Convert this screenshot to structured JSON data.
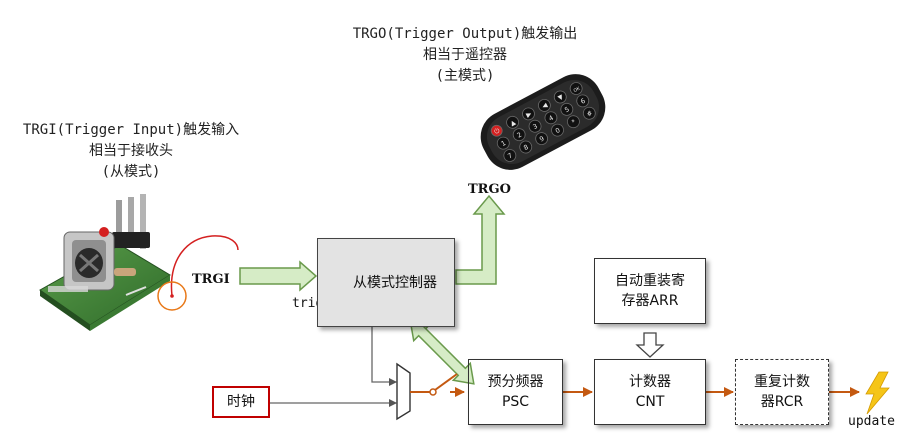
{
  "captions": {
    "trgo": [
      "TRGO(Trigger Output)触发输出",
      "相当于遥控器",
      "(主模式)"
    ],
    "trgi": [
      "TRGI(Trigger Input)触发输入",
      "相当于接收头",
      "(从模式)"
    ]
  },
  "labels": {
    "trgo": "TRGO",
    "trgi": "TRGI",
    "trigger": "trigger",
    "update": "update"
  },
  "blocks": {
    "slave_controller": "从模式控制器",
    "clock": "时钟",
    "prescaler": [
      "预分频器",
      "PSC"
    ],
    "counter": [
      "计数器",
      "CNT"
    ],
    "auto_reload": [
      "自动重装寄",
      "存器ARR"
    ],
    "repetition": [
      "重复计数",
      "器RCR"
    ]
  },
  "remote_keys": [
    "⏻",
    "▲",
    "▶",
    "◀",
    "▼",
    "OK",
    "1",
    "2",
    "3",
    "4",
    "5",
    "6",
    "7",
    "8",
    "9",
    "0",
    "*",
    "#"
  ],
  "colors": {
    "green_arrow_fill": "#d6ecc6",
    "green_arrow_stroke": "#6a9a4c",
    "orange_line": "#c45911",
    "clock_border": "#c00000",
    "controller_fill": "#e3e3e3",
    "bolt": "#f5c518"
  }
}
